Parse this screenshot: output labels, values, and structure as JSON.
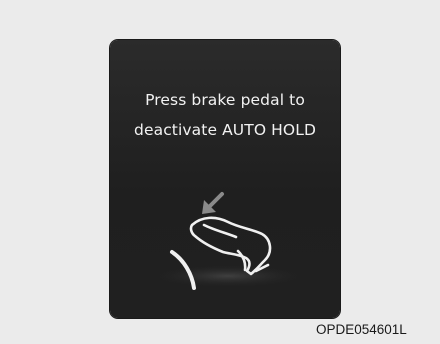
{
  "display": {
    "message_line1": "Press brake pedal to",
    "message_line2": "deactivate AUTO HOLD",
    "icons": [
      "arrow-down-left-icon",
      "foot-on-brake-pedal-icon",
      "pedal-arc-icon"
    ]
  },
  "caption": "OPDE054601L",
  "colors": {
    "screen_background": "#222222",
    "text": "#f2f2f2",
    "arrow": "#8a8a8a",
    "page_background": "#ebebeb"
  }
}
